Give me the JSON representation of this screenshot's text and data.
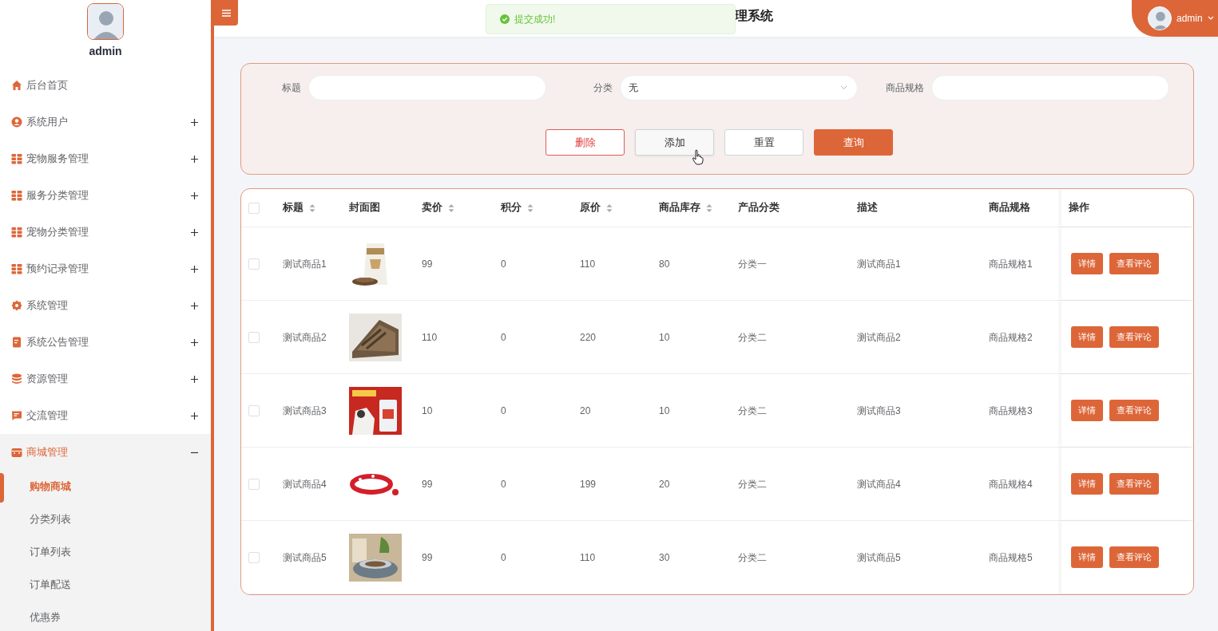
{
  "sidebar": {
    "user": {
      "name": "admin"
    },
    "items": [
      {
        "label": "后台首页"
      },
      {
        "label": "系统用户",
        "expanded": false
      },
      {
        "label": "宠物服务管理",
        "expanded": false
      },
      {
        "label": "服务分类管理",
        "expanded": false
      },
      {
        "label": "宠物分类管理",
        "expanded": false
      },
      {
        "label": "预约记录管理",
        "expanded": false
      },
      {
        "label": "系统管理",
        "expanded": false
      },
      {
        "label": "系统公告管理",
        "expanded": false
      },
      {
        "label": "资源管理",
        "expanded": false
      },
      {
        "label": "交流管理",
        "expanded": false
      },
      {
        "label": "商城管理",
        "expanded": true,
        "children": [
          {
            "label": "购物商城",
            "selected": true
          },
          {
            "label": "分类列表",
            "selected": false
          },
          {
            "label": "订单列表",
            "selected": false
          },
          {
            "label": "订单配送",
            "selected": false
          },
          {
            "label": "优惠券",
            "selected": false
          }
        ]
      }
    ]
  },
  "header": {
    "title": "理系统",
    "user": "admin"
  },
  "toast": {
    "message": "提交成功!"
  },
  "filters": [
    {
      "label": "标题",
      "kind": "text"
    },
    {
      "label": "分类",
      "kind": "select",
      "value": "无"
    },
    {
      "label": "商品规格",
      "kind": "text"
    }
  ],
  "buttons": [
    {
      "label": "删除",
      "kind": "danger",
      "hovered": false
    },
    {
      "label": "添加",
      "kind": "default",
      "hovered": true
    },
    {
      "label": "重置",
      "kind": "default",
      "hovered": false
    },
    {
      "label": "查询",
      "kind": "primary",
      "hovered": false
    }
  ],
  "table": {
    "select_all": {
      "checked": false
    },
    "columns": [
      {
        "label": "标题",
        "kind": "text",
        "sortable": true
      },
      {
        "label": "封面图",
        "kind": "picture",
        "sortable": false
      },
      {
        "label": "卖价",
        "kind": "text",
        "sortable": true
      },
      {
        "label": "积分",
        "kind": "text",
        "sortable": true
      },
      {
        "label": "原价",
        "kind": "text",
        "sortable": true
      },
      {
        "label": "商品库存",
        "kind": "text",
        "sortable": true
      },
      {
        "label": "产品分类",
        "kind": "text",
        "sortable": false
      },
      {
        "label": "描述",
        "kind": "text",
        "sortable": false
      },
      {
        "label": "商品规格",
        "kind": "text",
        "sortable": false
      },
      {
        "label": "操作",
        "kind": "actions",
        "sortable": false
      }
    ],
    "rows": [
      {
        "checked": false,
        "cells": [
          "测试商品1",
          {
            "kind": "picture"
          },
          "99",
          "0",
          "110",
          "80",
          "分类一",
          "测试商品1",
          "商品规格1",
          {
            "kind": "actions",
            "buttons": [
              "详情",
              "查看评论"
            ]
          }
        ]
      },
      {
        "checked": false,
        "cells": [
          "测试商品2",
          {
            "kind": "picture"
          },
          "110",
          "0",
          "220",
          "10",
          "分类二",
          "测试商品2",
          "商品规格2",
          {
            "kind": "actions",
            "buttons": [
              "详情",
              "查看评论"
            ]
          }
        ]
      },
      {
        "checked": false,
        "cells": [
          "测试商品3",
          {
            "kind": "picture"
          },
          "10",
          "0",
          "20",
          "10",
          "分类二",
          "测试商品3",
          "商品规格3",
          {
            "kind": "actions",
            "buttons": [
              "详情",
              "查看评论"
            ]
          }
        ]
      },
      {
        "checked": false,
        "cells": [
          "测试商品4",
          {
            "kind": "picture"
          },
          "99",
          "0",
          "199",
          "20",
          "分类二",
          "测试商品4",
          "商品规格4",
          {
            "kind": "actions",
            "buttons": [
              "详情",
              "查看评论"
            ]
          }
        ]
      },
      {
        "checked": false,
        "cells": [
          "测试商品5",
          {
            "kind": "picture"
          },
          "99",
          "0",
          "110",
          "30",
          "分类二",
          "测试商品5",
          "商品规格5",
          {
            "kind": "actions",
            "buttons": [
              "详情",
              "查看评论"
            ]
          }
        ]
      }
    ]
  }
}
